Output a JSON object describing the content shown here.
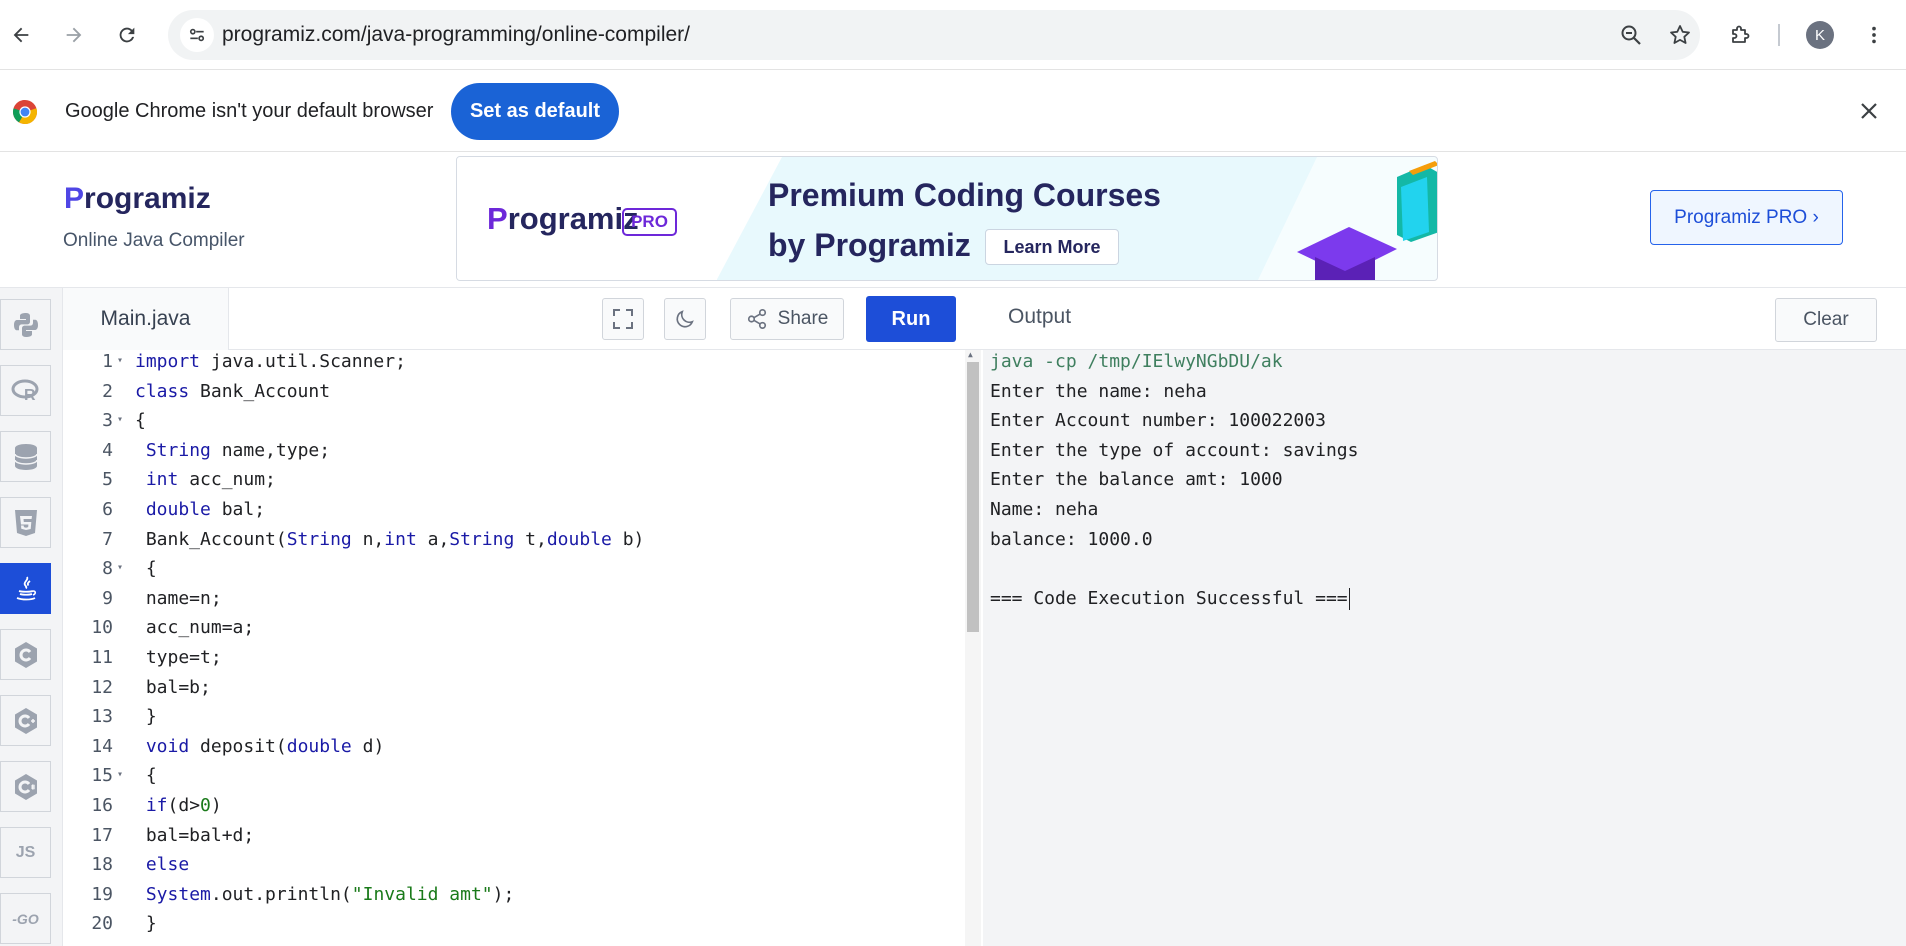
{
  "browser": {
    "url": "programiz.com/java-programming/online-compiler/",
    "profile_initial": "K"
  },
  "infobar": {
    "message": "Google Chrome isn't your default browser",
    "set_default_label": "Set as default"
  },
  "site": {
    "brand": "Programiz",
    "subtitle": "Online Java Compiler",
    "pro_button": "Programiz PRO ›"
  },
  "ad": {
    "logo": "Programiz",
    "badge": "PRO",
    "title_line1": "Premium Coding Courses",
    "title_line2": "by Programiz",
    "cta": "Learn More"
  },
  "languages": [
    {
      "name": "Python",
      "icon": "python-icon"
    },
    {
      "name": "R",
      "icon": "r-lang-icon"
    },
    {
      "name": "SQL",
      "icon": "database-icon"
    },
    {
      "name": "HTML",
      "icon": "html5-icon"
    },
    {
      "name": "Java",
      "icon": "java-icon",
      "active": true
    },
    {
      "name": "C",
      "icon": "c-lang-icon"
    },
    {
      "name": "C++",
      "icon": "cpp-icon"
    },
    {
      "name": "C#",
      "icon": "csharp-icon"
    },
    {
      "name": "JS",
      "icon": "javascript-icon",
      "text": "JS"
    },
    {
      "name": "Go",
      "icon": "go-icon",
      "text": "-GO"
    }
  ],
  "editor": {
    "file_name": "Main.java",
    "share_label": "Share",
    "run_label": "Run",
    "lines": [
      {
        "n": "1",
        "fold": true,
        "code": "<span class=\"kw\">import</span> java.util.Scanner;"
      },
      {
        "n": "2",
        "fold": false,
        "code": "<span class=\"kw\">class</span> Bank_Account"
      },
      {
        "n": "3",
        "fold": true,
        "code": "{"
      },
      {
        "n": "4",
        "fold": false,
        "code": " <span class=\"kw\">String</span> name,type;"
      },
      {
        "n": "5",
        "fold": false,
        "code": " <span class=\"kw\">int</span> acc_num;"
      },
      {
        "n": "6",
        "fold": false,
        "code": " <span class=\"kw\">double</span> bal;"
      },
      {
        "n": "7",
        "fold": false,
        "code": " Bank_Account(<span class=\"kw\">String</span> n,<span class=\"kw\">int</span> a,<span class=\"kw\">String</span> t,<span class=\"kw\">double</span> b)"
      },
      {
        "n": "8",
        "fold": true,
        "code": " {"
      },
      {
        "n": "9",
        "fold": false,
        "code": " name=n;"
      },
      {
        "n": "10",
        "fold": false,
        "code": " acc_num=a;"
      },
      {
        "n": "11",
        "fold": false,
        "code": " type=t;"
      },
      {
        "n": "12",
        "fold": false,
        "code": " bal=b;"
      },
      {
        "n": "13",
        "fold": false,
        "code": " }"
      },
      {
        "n": "14",
        "fold": false,
        "code": " <span class=\"kw\">void</span> deposit(<span class=\"kw\">double</span> d)"
      },
      {
        "n": "15",
        "fold": true,
        "code": " {"
      },
      {
        "n": "16",
        "fold": false,
        "code": " <span class=\"kw\">if</span>(d&gt;<span class=\"str\">0</span>)"
      },
      {
        "n": "17",
        "fold": false,
        "code": " bal=bal+d;"
      },
      {
        "n": "18",
        "fold": false,
        "code": " <span class=\"kw\">else</span>"
      },
      {
        "n": "19",
        "fold": false,
        "code": " <span class=\"kw\">System</span>.out.println(<span class=\"str\">\"Invalid amt\"</span>);"
      },
      {
        "n": "20",
        "fold": false,
        "code": " }"
      }
    ]
  },
  "output": {
    "title": "Output",
    "clear_label": "Clear",
    "lines": [
      "java -cp /tmp/IElwyNGbDU/ak",
      "Enter the name: neha",
      "Enter Account number: 100022003",
      "Enter the type of account: savings",
      "Enter the balance amt: 1000",
      "Name: neha",
      "balance: 1000.0",
      "",
      "=== Code Execution Successful ==="
    ]
  },
  "colors": {
    "accent": "#1d4ed8",
    "chrome_blue": "#1a63d6",
    "keyword": "#1a1aa6",
    "string": "#1a7a1a"
  }
}
